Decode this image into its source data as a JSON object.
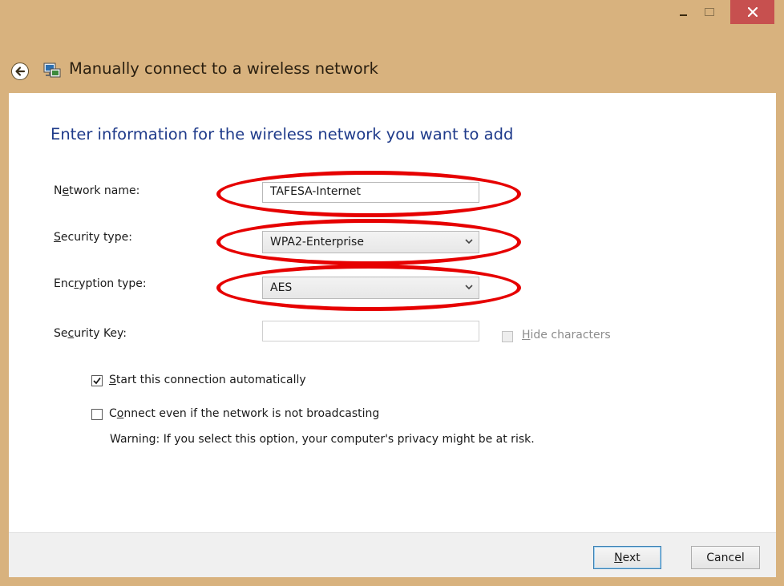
{
  "window": {
    "title": "Manually connect to a wireless network",
    "controls": {
      "minimize": "minimize-icon",
      "maximize": "maximize-icon",
      "close": "close-icon"
    }
  },
  "form": {
    "heading": "Enter information for the wireless network you want to add",
    "network_name": {
      "label_pre": "N",
      "label_key": "e",
      "label_post": "twork name:",
      "value": "TAFESA-Internet"
    },
    "security_type": {
      "label_pre": "",
      "label_key": "S",
      "label_post": "ecurity type:",
      "value": "WPA2-Enterprise"
    },
    "encryption_type": {
      "label_pre": "Enc",
      "label_key": "r",
      "label_post": "yption type:",
      "value": "AES"
    },
    "security_key": {
      "label_pre": "Se",
      "label_key": "c",
      "label_post": "urity Key:",
      "value": ""
    },
    "hide_characters": {
      "label_pre": "",
      "label_key": "H",
      "label_post": "ide characters",
      "checked": false,
      "enabled": false
    },
    "auto_start": {
      "label_pre": "",
      "label_key": "S",
      "label_post": "tart this connection automatically",
      "checked": true
    },
    "connect_hidden": {
      "label_pre": "C",
      "label_key": "o",
      "label_post": "nnect even if the network is not broadcasting",
      "checked": false
    },
    "warning": "Warning: If you select this option, your computer's privacy might be at risk."
  },
  "footer": {
    "next": {
      "label_pre": "",
      "label_key": "N",
      "label_post": "ext"
    },
    "cancel": "Cancel"
  },
  "colors": {
    "titlebar": "#d8b27e",
    "close": "#c7504f",
    "heading": "#1e3a8a",
    "annotation": "#e60000"
  }
}
